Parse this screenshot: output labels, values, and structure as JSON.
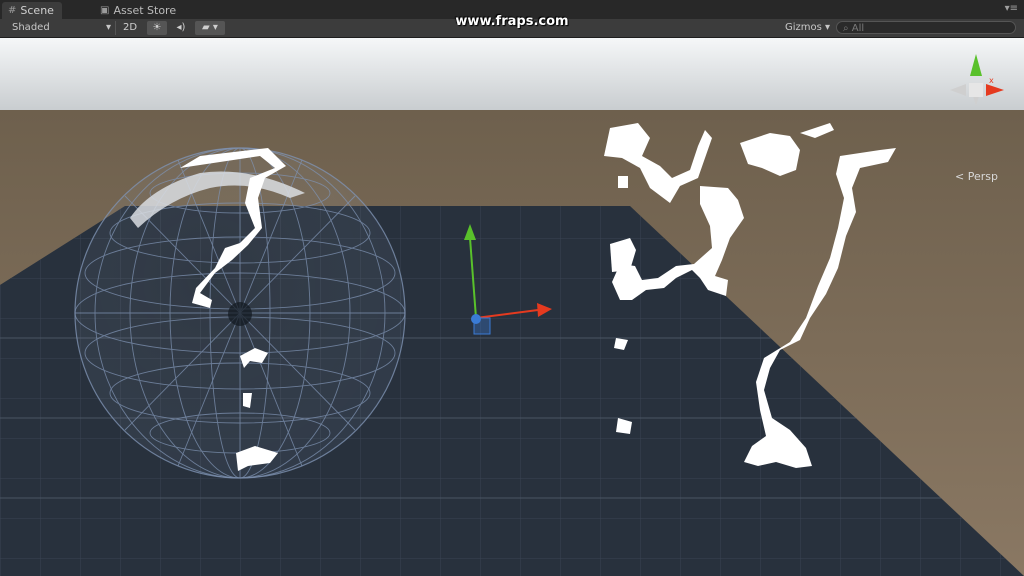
{
  "tabs": [
    {
      "label": "Scene",
      "icon": "scene-grid-icon"
    },
    {
      "label": "Asset Store",
      "icon": "store-bag-icon"
    }
  ],
  "toolbar": {
    "shading_mode": "Shaded",
    "mode_2d": "2D",
    "lighting_icon": "sun-icon",
    "audio_icon": "speaker-icon",
    "effects_icon": "image-icon",
    "gizmos_label": "Gizmos",
    "search_placeholder": "All"
  },
  "overlay": {
    "watermark": "www.fraps.com"
  },
  "scene": {
    "projection_label": "Persp",
    "axis_colors": {
      "x": "#e53a1f",
      "y": "#59c12b",
      "z": "#3a7bd5"
    },
    "sky_color": "#d9dde0",
    "ground_color": "#7d6c55",
    "plane_color": "#28313d"
  }
}
